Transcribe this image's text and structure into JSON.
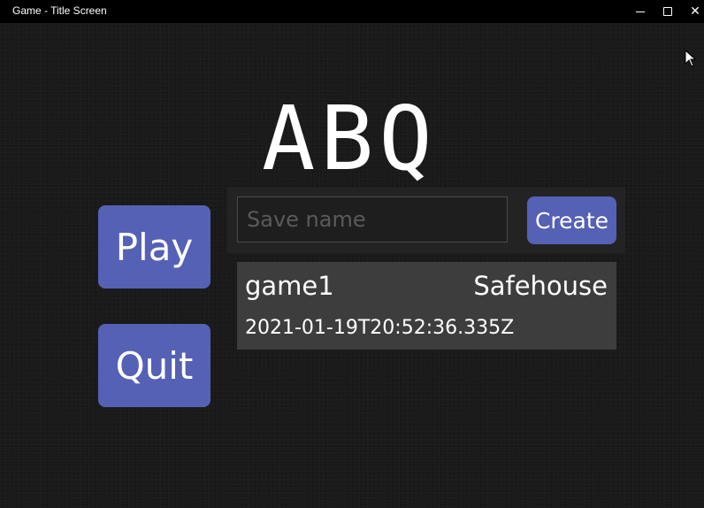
{
  "window": {
    "title": "Game - Title Screen",
    "minimize_icon": "minimize-icon",
    "maximize_icon": "maximize-icon",
    "close_icon": "close-icon",
    "close_glyph": "✕"
  },
  "game": {
    "title": "ABQ"
  },
  "menu": {
    "play_label": "Play",
    "quit_label": "Quit"
  },
  "new_save": {
    "placeholder": "Save name",
    "value": "",
    "create_label": "Create"
  },
  "saves": [
    {
      "name": "game1",
      "location": "Safehouse",
      "timestamp": "2021-01-19T20:52:36.335Z"
    }
  ],
  "colors": {
    "background": "#1a1a1a",
    "button": "#5561b5",
    "panel": "#232323",
    "slot": "#3d3d3d",
    "text": "#ffffff"
  }
}
